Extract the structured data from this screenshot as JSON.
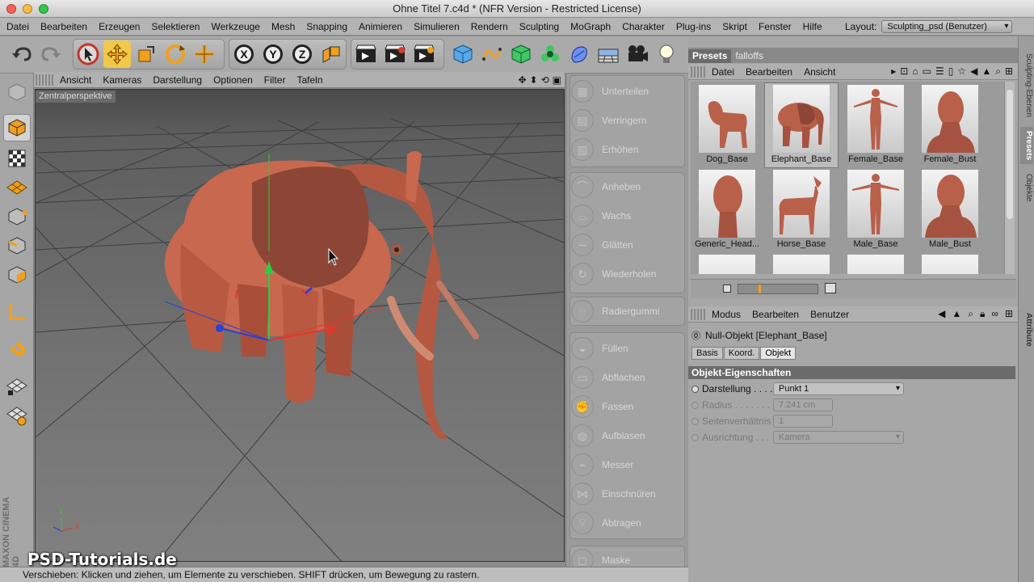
{
  "window": {
    "title": "Ohne Titel 7.c4d * (NFR Version - Restricted License)"
  },
  "menubar": {
    "items": [
      "Datei",
      "Bearbeiten",
      "Erzeugen",
      "Selektieren",
      "Werkzeuge",
      "Mesh",
      "Snapping",
      "Animieren",
      "Simulieren",
      "Rendern",
      "Sculpting",
      "MoGraph",
      "Charakter",
      "Plug-ins",
      "Skript",
      "Fenster",
      "Hilfe"
    ],
    "layout_label": "Layout:",
    "layout_value": "Sculpting_psd (Benutzer)"
  },
  "toolbar": {
    "axis_x": "X",
    "axis_y": "Y",
    "axis_z": "Z"
  },
  "viewport": {
    "menu": [
      "Ansicht",
      "Kameras",
      "Darstellung",
      "Optionen",
      "Filter",
      "Tafeln"
    ],
    "camera_label": "Zentralperspektive",
    "axis_y": "Y",
    "axis_x": "X"
  },
  "sculpt": {
    "tools": [
      "Unterteilen",
      "Verringern",
      "Erhöhen",
      "Anheben",
      "Wachs",
      "Glätten",
      "Wiederholen",
      "Radiergummi",
      "Füllen",
      "Abflachen",
      "Fassen",
      "Aufblasen",
      "Messer",
      "Einschnüren",
      "Abtragen",
      "Maske"
    ]
  },
  "presets": {
    "tabs": [
      "Presets",
      "falloffs"
    ],
    "menu": [
      "Datei",
      "Bearbeiten",
      "Ansicht"
    ],
    "items": [
      "Dog_Base",
      "Elephant_Base",
      "Female_Base",
      "Female_Bust",
      "Generic_Head...",
      "Horse_Base",
      "Male_Base",
      "Male_Bust"
    ],
    "selected": "Elephant_Base"
  },
  "attributes": {
    "menu": [
      "Modus",
      "Bearbeiten",
      "Benutzer"
    ],
    "object_name": "Null-Objekt [Elephant_Base]",
    "tabs": [
      "Basis",
      "Koord.",
      "Objekt"
    ],
    "active_tab": "Objekt",
    "section": "Objekt-Eigenschaften",
    "props": [
      {
        "label": "Darstellung . . . .",
        "value": "Punkt 1"
      },
      {
        "label": "Radius . . . . . . . .",
        "value": "7.241 cm"
      },
      {
        "label": "Seitenverhältnis",
        "value": "1"
      },
      {
        "label": "Ausrichtung . . . .",
        "value": "Kamera"
      }
    ]
  },
  "side_tabs": [
    "Sculpting-Ebenen",
    "Presets",
    "Objekte",
    "Attribute"
  ],
  "status": {
    "text": "Verschieben: Klicken und ziehen, um Elemente zu verschieben. SHIFT drücken, um Bewegung zu rastern."
  },
  "brand": {
    "watermark": "PSD-Tutorials.de",
    "vendor": "MAXON CINEMA 4D"
  },
  "colors": {
    "accent_orange": "#f0a01e",
    "elephant": "#c8684f",
    "axis_green": "#2ecc40",
    "axis_red": "#e0392b",
    "axis_blue": "#2843d8"
  }
}
